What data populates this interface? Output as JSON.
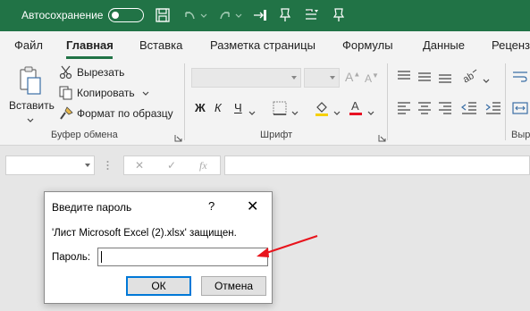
{
  "titlebar": {
    "autosave_label": "Автосохранение",
    "accent_color": "#217346"
  },
  "tabs": [
    {
      "label": "Файл"
    },
    {
      "label": "Главная"
    },
    {
      "label": "Вставка"
    },
    {
      "label": "Разметка страницы"
    },
    {
      "label": "Формулы"
    },
    {
      "label": "Данные"
    },
    {
      "label": "Реценз"
    }
  ],
  "ribbon": {
    "clipboard": {
      "paste_label": "Вставить",
      "cut_label": "Вырезать",
      "copy_label": "Копировать",
      "format_painter_label": "Формат по образцу",
      "group_label": "Буфер обмена"
    },
    "font": {
      "bold": "Ж",
      "italic": "К",
      "underline": "Ч",
      "group_label": "Шрифт"
    },
    "alignment": {
      "group_label": "Выр"
    }
  },
  "formula_bar": {
    "fx": "fx",
    "cancel_glyph": "✕",
    "enter_glyph": "✓"
  },
  "dialog": {
    "title": "Введите пароль",
    "help": "?",
    "close": "✕",
    "message": "'Лист Microsoft Excel (2).xlsx' защищен.",
    "password_label": "Пароль:",
    "password_value": "",
    "ok_label": "ОК",
    "cancel_label": "Отмена"
  },
  "annotation": {
    "arrow_color": "#e8141c"
  }
}
